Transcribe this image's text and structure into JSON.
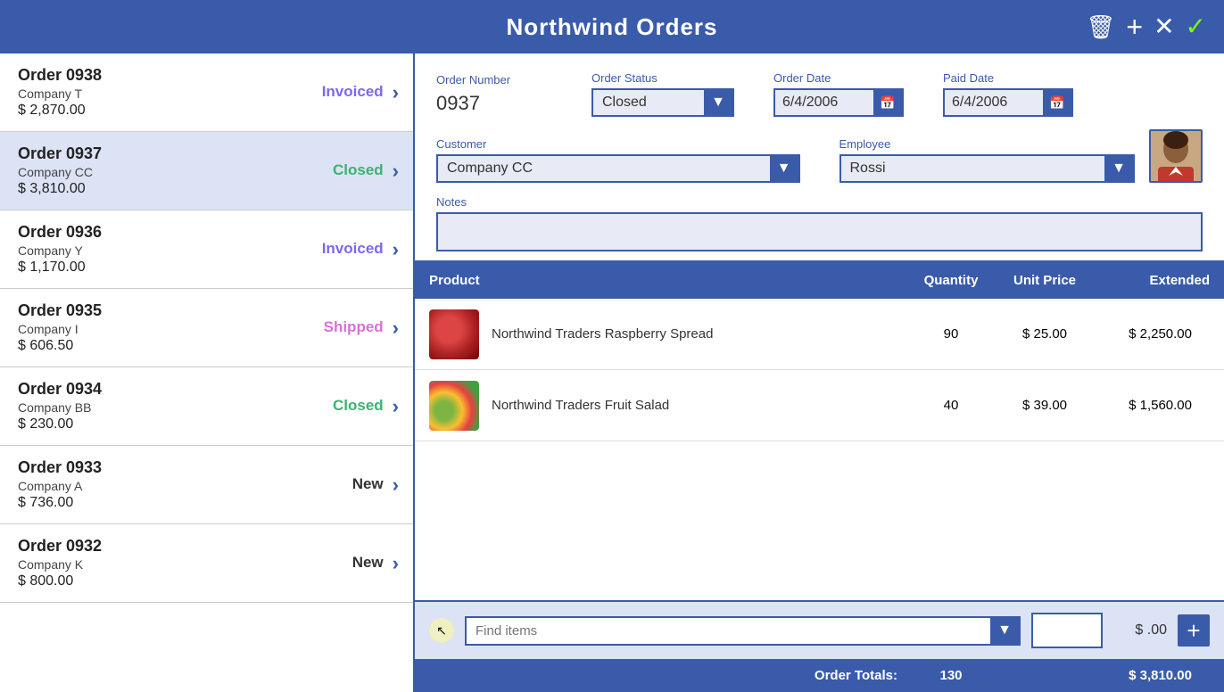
{
  "app": {
    "title": "Northwind Orders"
  },
  "header": {
    "delete_label": "🗑",
    "add_label": "+",
    "close_label": "✕",
    "confirm_label": "✓"
  },
  "orders": [
    {
      "id": "0938",
      "name": "Order 0938",
      "company": "Company T",
      "amount": "$ 2,870.00",
      "status": "Invoiced",
      "status_class": "status-invoiced"
    },
    {
      "id": "0937",
      "name": "Order 0937",
      "company": "Company CC",
      "amount": "$ 3,810.00",
      "status": "Closed",
      "status_class": "status-closed"
    },
    {
      "id": "0936",
      "name": "Order 0936",
      "company": "Company Y",
      "amount": "$ 1,170.00",
      "status": "Invoiced",
      "status_class": "status-invoiced"
    },
    {
      "id": "0935",
      "name": "Order 0935",
      "company": "Company I",
      "amount": "$ 606.50",
      "status": "Shipped",
      "status_class": "status-shipped"
    },
    {
      "id": "0934",
      "name": "Order 0934",
      "company": "Company BB",
      "amount": "$ 230.00",
      "status": "Closed",
      "status_class": "status-closed"
    },
    {
      "id": "0933",
      "name": "Order 0933",
      "company": "Company A",
      "amount": "$ 736.00",
      "status": "New",
      "status_class": "status-new"
    },
    {
      "id": "0932",
      "name": "Order 0932",
      "company": "Company K",
      "amount": "$ 800.00",
      "status": "New",
      "status_class": "status-new"
    }
  ],
  "detail": {
    "order_number_label": "Order Number",
    "order_number_value": "0937",
    "order_status_label": "Order Status",
    "order_status_value": "Closed",
    "order_date_label": "Order Date",
    "order_date_value": "6/4/2006",
    "paid_date_label": "Paid Date",
    "paid_date_value": "6/4/2006",
    "customer_label": "Customer",
    "customer_value": "Company CC",
    "employee_label": "Employee",
    "employee_value": "Rossi",
    "notes_label": "Notes",
    "notes_value": ""
  },
  "table": {
    "col_product": "Product",
    "col_quantity": "Quantity",
    "col_unit_price": "Unit Price",
    "col_extended": "Extended",
    "rows": [
      {
        "product": "Northwind Traders Raspberry Spread",
        "quantity": "90",
        "unit_price": "$ 25.00",
        "extended": "$ 2,250.00"
      },
      {
        "product": "Northwind Traders Fruit Salad",
        "quantity": "40",
        "unit_price": "$ 39.00",
        "extended": "$ 1,560.00"
      }
    ]
  },
  "add_row": {
    "find_placeholder": "Find items",
    "quantity_value": "",
    "price_display": "$ .00",
    "add_btn_label": "+"
  },
  "totals": {
    "label": "Order Totals:",
    "quantity": "130",
    "amount": "$ 3,810.00"
  }
}
